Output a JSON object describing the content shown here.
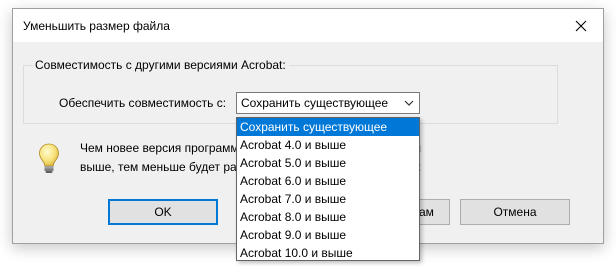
{
  "window": {
    "title": "Уменьшить размер файла"
  },
  "group": {
    "label": "Совместимость с другими версиями Acrobat:"
  },
  "compat": {
    "label": "Обеспечить совместимость с:",
    "selected": "Сохранить существующее"
  },
  "dropdown": {
    "options": [
      "Сохранить существующее",
      "Acrobat 4.0 и выше",
      "Acrobat 5.0 и выше",
      "Acrobat 6.0 и выше",
      "Acrobat 7.0 и выше",
      "Acrobat 8.0 и выше",
      "Acrobat 9.0 и выше",
      "Acrobat 10.0 и выше"
    ]
  },
  "info": {
    "line1_left": "Чем новее версия программ",
    "line2_left": "выше, тем меньше будет ра",
    "line1_right": "ı",
    "line2_right": ":"
  },
  "buttons": {
    "ok": "OK",
    "apply_partial": "ам",
    "cancel": "Отмена"
  },
  "icons": {
    "bulb": "lightbulb-icon",
    "close": "close-icon",
    "dropdown_arrow": "chevron-down-icon"
  },
  "colors": {
    "selection": "#0078d7",
    "focus_border": "#0078d7"
  }
}
